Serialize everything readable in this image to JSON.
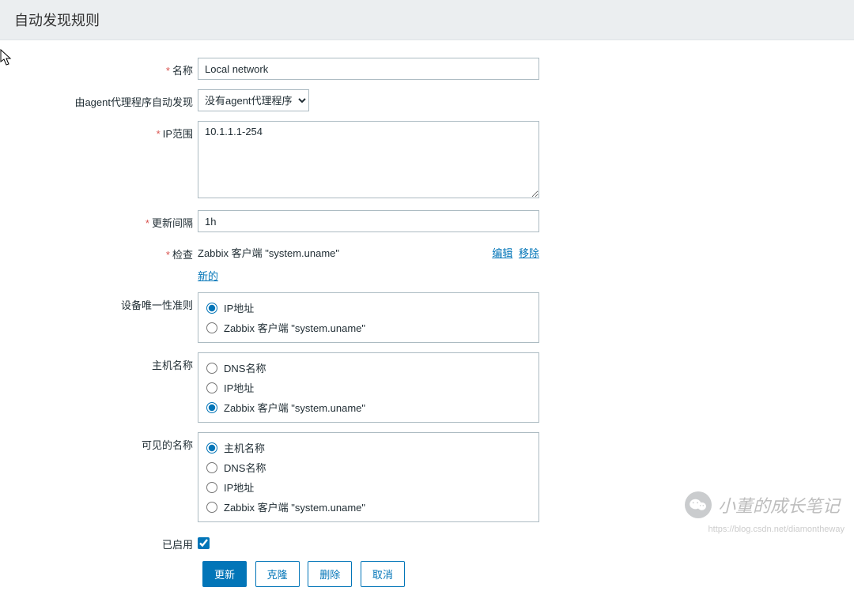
{
  "header": {
    "title": "自动发现规则"
  },
  "form": {
    "name": {
      "label": "名称",
      "value": "Local network",
      "required": true
    },
    "proxy": {
      "label": "由agent代理程序自动发现",
      "selected": "没有agent代理程序"
    },
    "iprange": {
      "label": "IP范围",
      "value": "10.1.1.1-254",
      "required": true
    },
    "interval": {
      "label": "更新间隔",
      "value": "1h",
      "required": true
    },
    "checks": {
      "label": "检查",
      "required": true,
      "items": [
        {
          "name": "Zabbix 客户端 \"system.uname\""
        }
      ],
      "edit": "编辑",
      "remove": "移除",
      "new": "新的"
    },
    "uniqueness": {
      "label": "设备唯一性准则",
      "options": [
        "IP地址",
        "Zabbix 客户端 \"system.uname\""
      ],
      "selected": 0
    },
    "hostname": {
      "label": "主机名称",
      "options": [
        "DNS名称",
        "IP地址",
        "Zabbix 客户端 \"system.uname\""
      ],
      "selected": 2
    },
    "visiblename": {
      "label": "可见的名称",
      "options": [
        "主机名称",
        "DNS名称",
        "IP地址",
        "Zabbix 客户端 \"system.uname\""
      ],
      "selected": 0
    },
    "enabled": {
      "label": "已启用",
      "checked": true
    }
  },
  "buttons": {
    "update": "更新",
    "clone": "克隆",
    "delete": "删除",
    "cancel": "取消"
  },
  "watermark": {
    "text": "小董的成长笔记"
  },
  "footer_url": "https://blog.csdn.net/diamontheway"
}
